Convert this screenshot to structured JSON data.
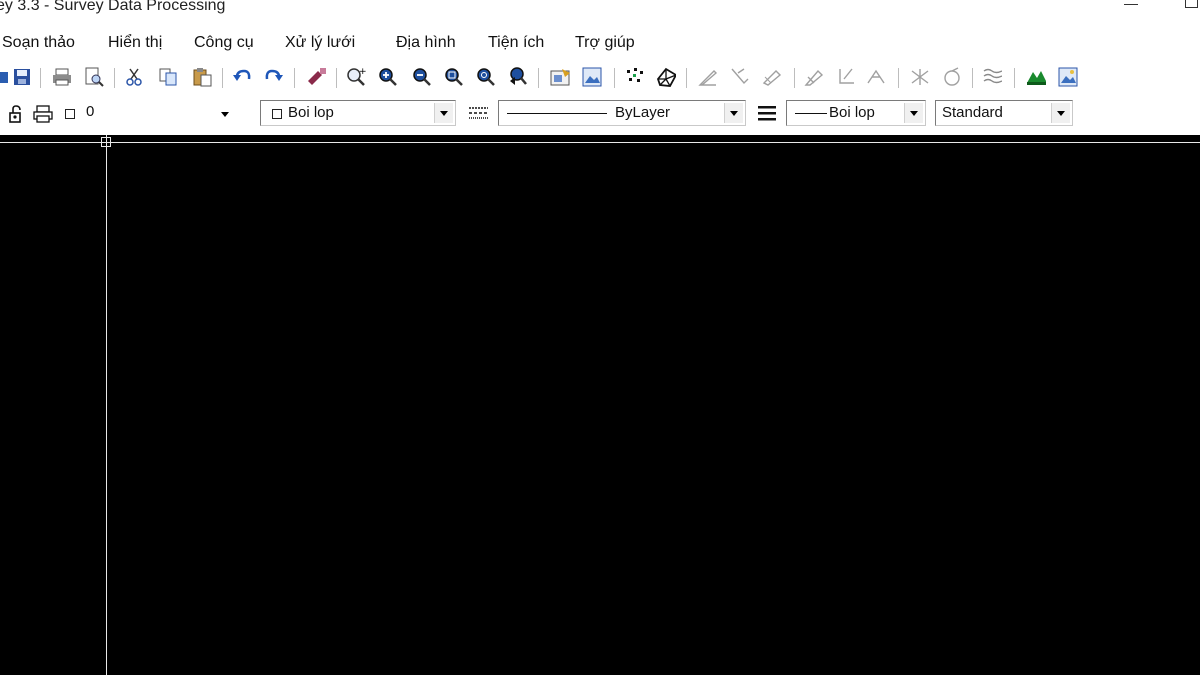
{
  "window": {
    "title": "ey 3.3 - Survey Data Processing",
    "minimize_icon": "minimize-icon",
    "maximize_icon": "maximize-icon"
  },
  "menu": {
    "items": [
      "Soạn thảo",
      "Hiển thị",
      "Công cụ",
      "Xử lý lưới",
      "Địa hình",
      "Tiện ích",
      "Trợ giúp"
    ]
  },
  "toolbar": {
    "icons": [
      "open-icon",
      "save-icon",
      "print-icon",
      "print-preview-icon",
      "cut-icon",
      "copy-icon",
      "paste-icon",
      "undo-icon",
      "redo-icon",
      "match-properties-icon",
      "zoom-realtime-icon",
      "zoom-in-icon",
      "zoom-out-icon",
      "zoom-window-icon",
      "zoom-all-icon",
      "zoom-previous-icon",
      "properties-icon",
      "image-icon",
      "points-icon",
      "surface-icon",
      "pen-1-icon",
      "pen-2-icon",
      "pen-3-icon",
      "pen-4-icon",
      "pen-5-icon",
      "pen-6-icon",
      "pen-7-icon",
      "pen-8-icon",
      "contour-icon",
      "terrain-icon",
      "picture-icon"
    ]
  },
  "properties_bar": {
    "layer_value": "0",
    "color_value": "Boi lop",
    "linetype_value": "ByLayer",
    "lineweight_value": "Boi lop",
    "style_value": "Standard"
  },
  "colors": {
    "canvas_bg": "#000000",
    "crosshair": "#e8e8e8",
    "toolbar_bg": "#ffffff"
  }
}
